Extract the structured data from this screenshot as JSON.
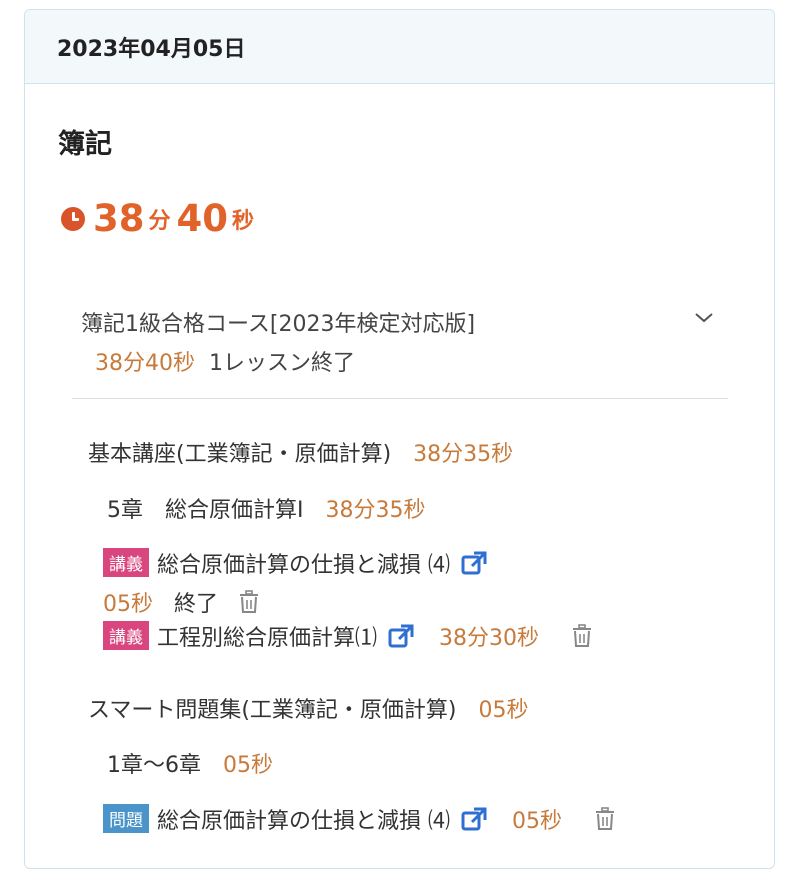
{
  "header": {
    "date": "2023年04月05日"
  },
  "subject": {
    "title": "簿記",
    "total_min": "38",
    "total_min_unit": "分",
    "total_sec": "40",
    "total_sec_unit": "秒",
    "icon": "clock-icon",
    "accent_color": "#e2632a"
  },
  "course": {
    "title": "簿記1級合格コース[2023年検定対応版]",
    "time": "38分40秒",
    "lessons_done": "1レッスン終了",
    "toggle_icon": "chevron-down-icon"
  },
  "sections": [
    {
      "title": "基本講座(工業簿記・原価計算)",
      "time": "38分35秒",
      "chapter": {
        "title": "5章　総合原価計算Ⅰ",
        "time": "38分35秒"
      },
      "lessons": [
        {
          "badge": "講義",
          "badge_color": "#d9457e",
          "title": "総合原価計算の仕損と減損 ⑷",
          "time": "05秒",
          "status": "終了"
        },
        {
          "badge": "講義",
          "badge_color": "#d9457e",
          "title": "工程別総合原価計算⑴",
          "time": "38分30秒"
        }
      ]
    },
    {
      "title": "スマート問題集(工業簿記・原価計算)",
      "time": "05秒",
      "chapter": {
        "title": "1章〜6章",
        "time": "05秒"
      },
      "lessons": [
        {
          "badge": "問題",
          "badge_color": "#4a94c9",
          "title": "総合原価計算の仕損と減損 ⑷",
          "time": "05秒"
        }
      ]
    }
  ]
}
